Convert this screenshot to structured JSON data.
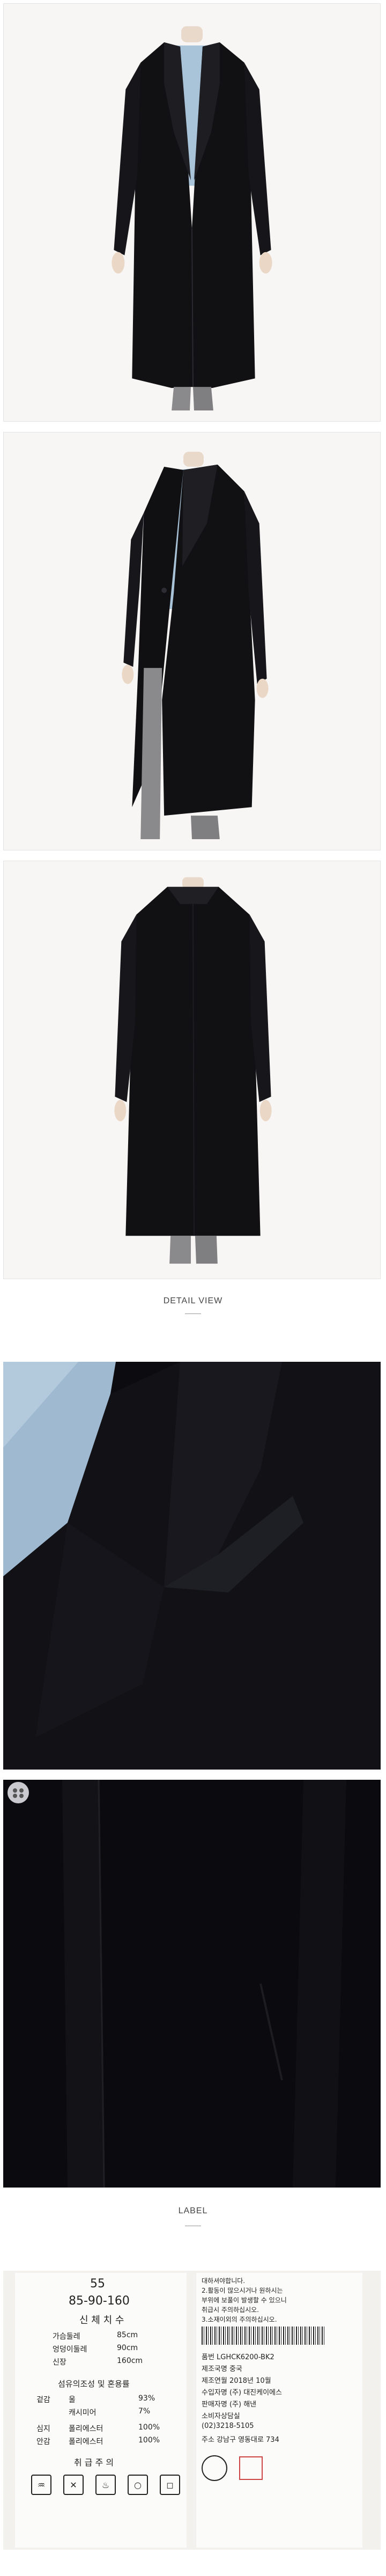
{
  "sections": {
    "detail_view": "DETAIL VIEW",
    "label": "LABEL"
  },
  "label_left": {
    "l1": "55",
    "l2": "85-90-160",
    "l3": "신 체 치 수",
    "l4": "가슴둘레",
    "l4v": "85cm",
    "l5": "엉덩이둘레",
    "l5v": "90cm",
    "l6": "신장",
    "l6v": "160cm",
    "l7": "섬유의조성 및 혼용률",
    "l8": "겉감",
    "l8a": "울",
    "l8v": "93%",
    "l9a": "캐시미어",
    "l9v": "7%",
    "l10": "심지",
    "l10a": "폴리에스터",
    "l10v": "100%",
    "l11": "안감",
    "l11a": "폴리에스터",
    "l11v": "100%",
    "l12": "취 급 주 의"
  },
  "label_right": {
    "r1": "대하셔야합니다.",
    "r2": "2.활동이 많으시거나 원하시는",
    "r3": "부위에 보풀이 발생할 수 있으니",
    "r4": "취급시 주의하십시오.",
    "r5": "3.소재이외의 주의하십시오.",
    "r6": "품번 LGHCK6200-BK2",
    "r7": "제조국명 중국",
    "r8": "제조연월 2018년 10월",
    "r9": "수입자명 (주) 대진케이에스",
    "r10": "판매자명 (주) 해낸",
    "r11": "소비자상담실",
    "r12": "(02)3218-5105",
    "r13": "주소 강남구 영동대로 734"
  }
}
